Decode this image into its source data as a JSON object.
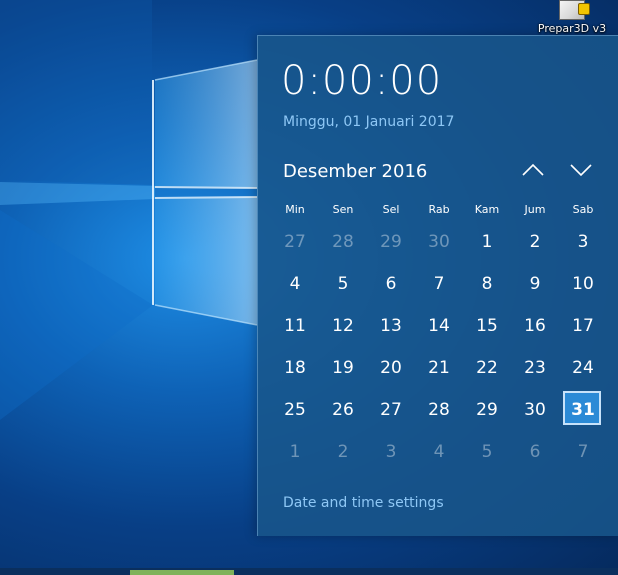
{
  "desktop": {
    "icon_label": "Prepar3D v3"
  },
  "flyout": {
    "time": "0:00:00",
    "long_date": "Minggu, 01 Januari 2017",
    "month_year": "Desember 2016",
    "weekdays": [
      "Min",
      "Sen",
      "Sel",
      "Rab",
      "Kam",
      "Jum",
      "Sab"
    ],
    "weeks": [
      [
        {
          "d": "27",
          "other": true
        },
        {
          "d": "28",
          "other": true
        },
        {
          "d": "29",
          "other": true
        },
        {
          "d": "30",
          "other": true
        },
        {
          "d": "1"
        },
        {
          "d": "2"
        },
        {
          "d": "3"
        }
      ],
      [
        {
          "d": "4"
        },
        {
          "d": "5"
        },
        {
          "d": "6"
        },
        {
          "d": "7"
        },
        {
          "d": "8"
        },
        {
          "d": "9"
        },
        {
          "d": "10"
        }
      ],
      [
        {
          "d": "11"
        },
        {
          "d": "12"
        },
        {
          "d": "13"
        },
        {
          "d": "14"
        },
        {
          "d": "15"
        },
        {
          "d": "16"
        },
        {
          "d": "17"
        }
      ],
      [
        {
          "d": "18"
        },
        {
          "d": "19"
        },
        {
          "d": "20"
        },
        {
          "d": "21"
        },
        {
          "d": "22"
        },
        {
          "d": "23"
        },
        {
          "d": "24"
        }
      ],
      [
        {
          "d": "25"
        },
        {
          "d": "26"
        },
        {
          "d": "27"
        },
        {
          "d": "28"
        },
        {
          "d": "29"
        },
        {
          "d": "30"
        },
        {
          "d": "31",
          "today": true
        }
      ],
      [
        {
          "d": "1",
          "other": true
        },
        {
          "d": "2",
          "other": true
        },
        {
          "d": "3",
          "other": true
        },
        {
          "d": "4",
          "other": true
        },
        {
          "d": "5",
          "other": true
        },
        {
          "d": "6",
          "other": true
        },
        {
          "d": "7",
          "other": true
        }
      ]
    ],
    "settings_link": "Date and time settings",
    "icons": {
      "prev": "chevron-up-icon",
      "next": "chevron-down-icon"
    }
  },
  "colors": {
    "accent_text": "#8ec7f5",
    "today_fill": "#2b8ad6",
    "flyout_bg": "#18568a"
  }
}
